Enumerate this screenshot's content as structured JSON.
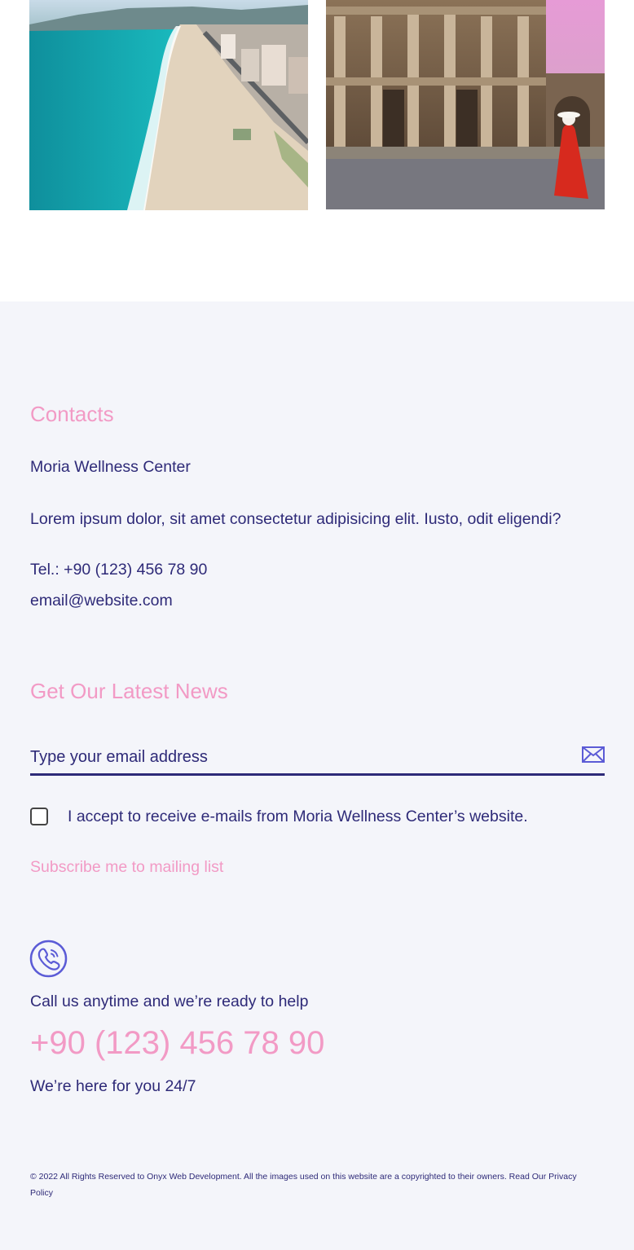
{
  "gallery": {
    "images": [
      {
        "name": "beach-coast-photo"
      },
      {
        "name": "ancient-library-ruins-photo"
      }
    ]
  },
  "contacts": {
    "heading": "Contacts",
    "company": "Moria Wellness Center",
    "description": "Lorem ipsum dolor, sit amet consectetur adipisicing elit. Iusto, odit eligendi?",
    "phone": "Tel.: +90 (123) 456 78 90",
    "email": "email@website.com"
  },
  "newsletter": {
    "heading": "Get Our Latest News",
    "email_placeholder": "Type your email address",
    "email_value": "",
    "send_icon": "envelope-icon",
    "consent_checked": false,
    "consent_label": "I accept to receive e-mails from Moria Wellness Center’s website.",
    "subscribe_label": "Subscribe me to mailing list"
  },
  "callout": {
    "icon": "phone-icon",
    "intro": "Call us anytime and we’re ready to help",
    "phone": "+90 (123) 456 78 90",
    "availability": "We’re here for you 24/7"
  },
  "footer": {
    "copyright": "© 2022 All Rights Reserved to Onyx Web Development. All the images used on this website are a copyrighted to their owners. Read Our",
    "privacy_link": "Privacy Policy"
  },
  "colors": {
    "accent_pink": "#f29ac5",
    "text_navy": "#2e2a78",
    "footer_bg": "#f4f5fa",
    "icon_blue": "#5b5bd6"
  }
}
